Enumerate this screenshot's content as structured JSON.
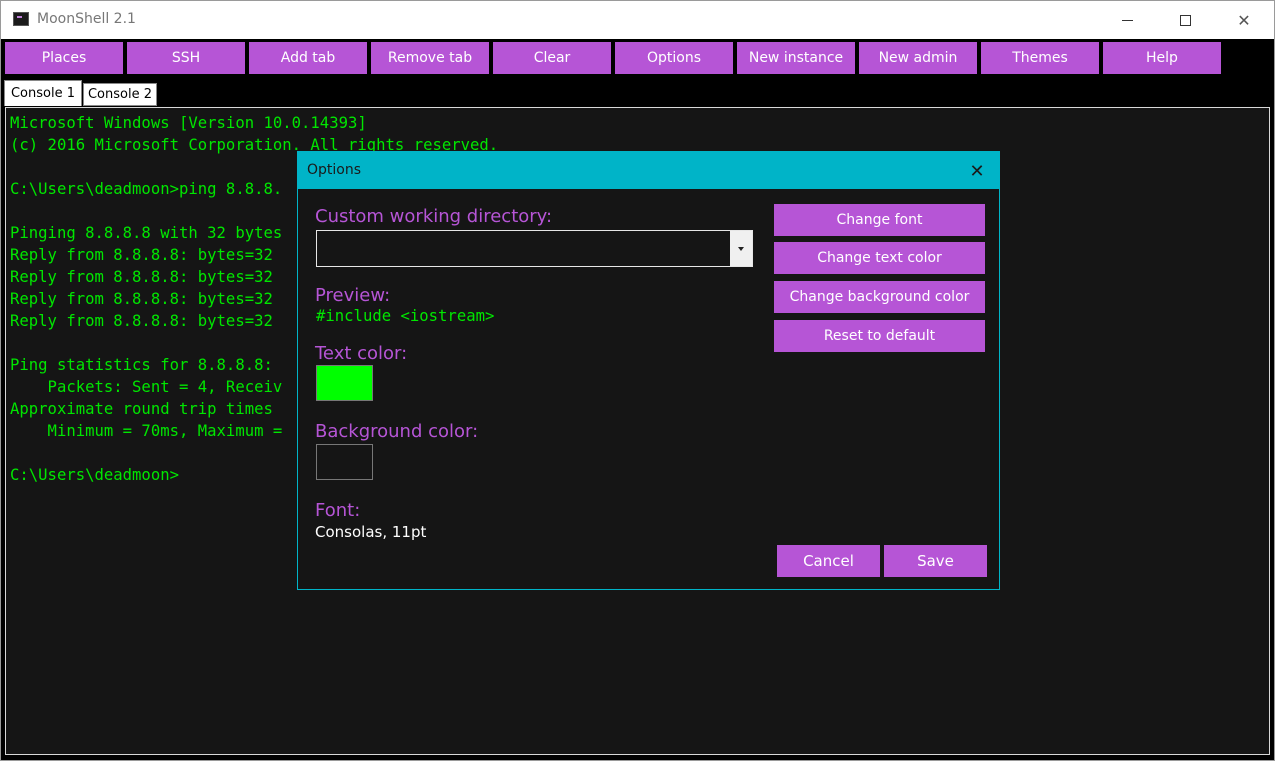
{
  "window": {
    "title": "MoonShell 2.1"
  },
  "toolbar": {
    "buttons": [
      {
        "label": "Places"
      },
      {
        "label": "SSH"
      },
      {
        "label": "Add tab"
      },
      {
        "label": "Remove tab"
      },
      {
        "label": "Clear"
      },
      {
        "label": "Options"
      },
      {
        "label": "New instance"
      },
      {
        "label": "New admin"
      },
      {
        "label": "Themes"
      },
      {
        "label": "Help"
      }
    ]
  },
  "tabs": [
    {
      "label": "Console 1",
      "active": true
    },
    {
      "label": "Console 2",
      "active": false
    }
  ],
  "console": {
    "text": "Microsoft Windows [Version 10.0.14393]\n(c) 2016 Microsoft Corporation. All rights reserved.\n\nC:\\Users\\deadmoon>ping 8.8.8.\n\nPinging 8.8.8.8 with 32 bytes\nReply from 8.8.8.8: bytes=32\nReply from 8.8.8.8: bytes=32\nReply from 8.8.8.8: bytes=32\nReply from 8.8.8.8: bytes=32\n\nPing statistics for 8.8.8.8:\n    Packets: Sent = 4, Receiv\nApproximate round trip times\n    Minimum = 70ms, Maximum =\n\nC:\\Users\\deadmoon>"
  },
  "dialog": {
    "title": "Options",
    "working_dir_label": "Custom working directory:",
    "working_dir_value": "",
    "preview_label": "Preview:",
    "preview_text": "#include <iostream>",
    "text_color_label": "Text color:",
    "text_color_value": "#00ff00",
    "bg_color_label": "Background color:",
    "bg_color_value": "#151515",
    "font_label": "Font:",
    "font_value": "Consolas, 11pt",
    "buttons": {
      "change_font": "Change font",
      "change_text_color": "Change text color",
      "change_bg_color": "Change background color",
      "reset": "Reset to default",
      "cancel": "Cancel",
      "save": "Save"
    }
  },
  "colors": {
    "accent": "#b655d6",
    "dialog_title": "#00b4c8",
    "console_text": "#00e600",
    "console_bg": "#151515"
  }
}
